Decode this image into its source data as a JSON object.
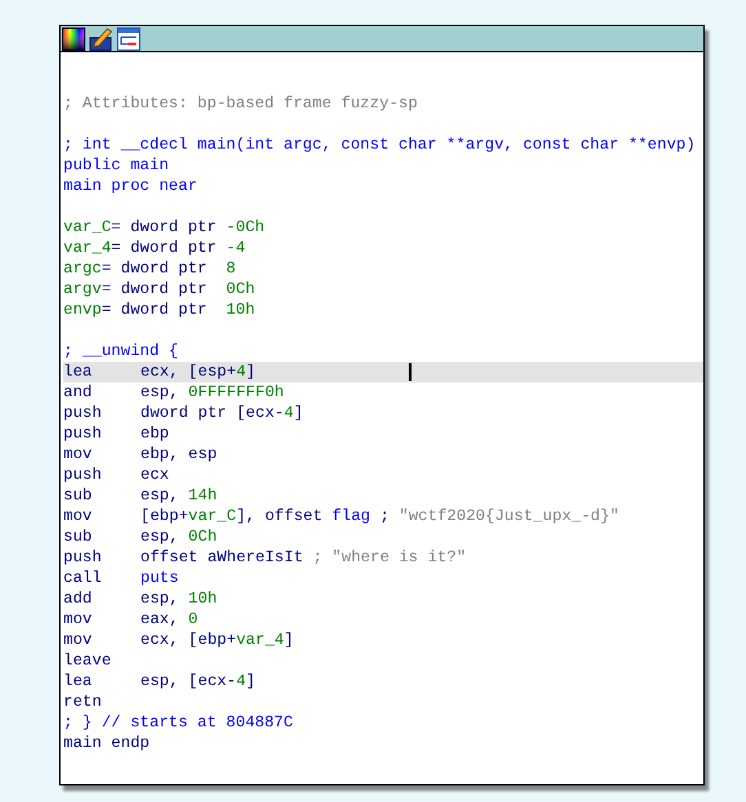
{
  "node": {
    "toolbar": [
      {
        "kind": "palette"
      },
      {
        "kind": "edit"
      },
      {
        "kind": "graph"
      }
    ],
    "blocks": [
      [
        {
          "kind": "directive",
          "selected": false,
          "segments": [
            {
              "text": "; Attributes: bp-based frame fuzzy-sp",
              "kind": "comment"
            }
          ]
        }
      ],
      [
        {
          "kind": "directive",
          "selected": false,
          "segments": [
            {
              "text": "; int __cdecl main(int argc, const char **argv, const char **envp)",
              "kind": "name"
            }
          ]
        },
        {
          "kind": "directive",
          "selected": false,
          "segments": [
            {
              "text": "public main",
              "kind": "name"
            }
          ]
        },
        {
          "kind": "directive",
          "selected": false,
          "segments": [
            {
              "text": "main proc near",
              "kind": "name"
            }
          ]
        }
      ],
      [
        {
          "kind": "directive",
          "selected": false,
          "segments": [
            {
              "text": "var_C",
              "kind": "var"
            },
            {
              "text": "= dword ptr ",
              "kind": "plain"
            },
            {
              "text": "-0Ch",
              "kind": "num"
            }
          ]
        },
        {
          "kind": "directive",
          "selected": false,
          "segments": [
            {
              "text": "var_4",
              "kind": "var"
            },
            {
              "text": "= dword ptr ",
              "kind": "plain"
            },
            {
              "text": "-4",
              "kind": "num"
            }
          ]
        },
        {
          "kind": "directive",
          "selected": false,
          "segments": [
            {
              "text": "argc",
              "kind": "var"
            },
            {
              "text": "= dword ptr  ",
              "kind": "plain"
            },
            {
              "text": "8",
              "kind": "num"
            }
          ]
        },
        {
          "kind": "directive",
          "selected": false,
          "segments": [
            {
              "text": "argv",
              "kind": "var"
            },
            {
              "text": "= dword ptr  ",
              "kind": "plain"
            },
            {
              "text": "0Ch",
              "kind": "num"
            }
          ]
        },
        {
          "kind": "directive",
          "selected": false,
          "segments": [
            {
              "text": "envp",
              "kind": "var"
            },
            {
              "text": "= dword ptr  ",
              "kind": "plain"
            },
            {
              "text": "10h",
              "kind": "num"
            }
          ]
        }
      ],
      [
        {
          "kind": "directive",
          "selected": false,
          "segments": [
            {
              "text": "; __unwind {",
              "kind": "name"
            }
          ]
        },
        {
          "kind": "instruction",
          "selected": true,
          "mnemonic": "lea",
          "segments": [
            {
              "text": "ecx, [esp+",
              "kind": "plain"
            },
            {
              "text": "4",
              "kind": "num"
            },
            {
              "text": "]",
              "kind": "plain"
            }
          ]
        },
        {
          "kind": "instruction",
          "selected": false,
          "mnemonic": "and",
          "segments": [
            {
              "text": "esp, ",
              "kind": "plain"
            },
            {
              "text": "0FFFFFFF0h",
              "kind": "num"
            }
          ]
        },
        {
          "kind": "instruction",
          "selected": false,
          "mnemonic": "push",
          "segments": [
            {
              "text": "dword ptr [ecx-",
              "kind": "plain"
            },
            {
              "text": "4",
              "kind": "num"
            },
            {
              "text": "]",
              "kind": "plain"
            }
          ]
        },
        {
          "kind": "instruction",
          "selected": false,
          "mnemonic": "push",
          "segments": [
            {
              "text": "ebp",
              "kind": "plain"
            }
          ]
        },
        {
          "kind": "instruction",
          "selected": false,
          "mnemonic": "mov",
          "segments": [
            {
              "text": "ebp, esp",
              "kind": "plain"
            }
          ]
        },
        {
          "kind": "instruction",
          "selected": false,
          "mnemonic": "push",
          "segments": [
            {
              "text": "ecx",
              "kind": "plain"
            }
          ]
        },
        {
          "kind": "instruction",
          "selected": false,
          "mnemonic": "sub",
          "segments": [
            {
              "text": "esp, ",
              "kind": "plain"
            },
            {
              "text": "14h",
              "kind": "num"
            }
          ]
        },
        {
          "kind": "instruction",
          "selected": false,
          "mnemonic": "mov",
          "segments": [
            {
              "text": "[ebp+",
              "kind": "plain"
            },
            {
              "text": "var_C",
              "kind": "var"
            },
            {
              "text": "], offset ",
              "kind": "plain"
            },
            {
              "text": "flag",
              "kind": "name"
            },
            {
              "text": " ; ",
              "kind": "plain"
            },
            {
              "text": "\"wctf2020{Just_upx_-d}\"",
              "kind": "comment"
            }
          ]
        },
        {
          "kind": "instruction",
          "selected": false,
          "mnemonic": "sub",
          "segments": [
            {
              "text": "esp, ",
              "kind": "plain"
            },
            {
              "text": "0Ch",
              "kind": "num"
            }
          ]
        },
        {
          "kind": "instruction",
          "selected": false,
          "mnemonic": "push",
          "segments": [
            {
              "text": "offset aWhereIsIt",
              "kind": "plain"
            },
            {
              "text": " ; \"where is it?\"",
              "kind": "comment"
            }
          ]
        },
        {
          "kind": "instruction",
          "selected": false,
          "mnemonic": "call",
          "segments": [
            {
              "text": "puts",
              "kind": "name"
            }
          ]
        },
        {
          "kind": "instruction",
          "selected": false,
          "mnemonic": "add",
          "segments": [
            {
              "text": "esp, ",
              "kind": "plain"
            },
            {
              "text": "10h",
              "kind": "num"
            }
          ]
        },
        {
          "kind": "instruction",
          "selected": false,
          "mnemonic": "mov",
          "segments": [
            {
              "text": "eax, ",
              "kind": "plain"
            },
            {
              "text": "0",
              "kind": "num"
            }
          ]
        },
        {
          "kind": "instruction",
          "selected": false,
          "mnemonic": "mov",
          "segments": [
            {
              "text": "ecx, [ebp+",
              "kind": "plain"
            },
            {
              "text": "var_4",
              "kind": "var"
            },
            {
              "text": "]",
              "kind": "plain"
            }
          ]
        },
        {
          "kind": "instruction",
          "selected": false,
          "mnemonic": "leave"
        },
        {
          "kind": "instruction",
          "selected": false,
          "mnemonic": "lea",
          "segments": [
            {
              "text": "esp, [ecx-",
              "kind": "plain"
            },
            {
              "text": "4",
              "kind": "num"
            },
            {
              "text": "]",
              "kind": "plain"
            }
          ]
        },
        {
          "kind": "instruction",
          "selected": false,
          "mnemonic": "retn"
        },
        {
          "kind": "directive",
          "selected": false,
          "segments": [
            {
              "text": "; } // starts at 804887C",
              "kind": "name"
            }
          ]
        },
        {
          "kind": "directive",
          "selected": false,
          "segments": [
            {
              "text": "main endp",
              "kind": "plain"
            }
          ]
        }
      ]
    ]
  }
}
